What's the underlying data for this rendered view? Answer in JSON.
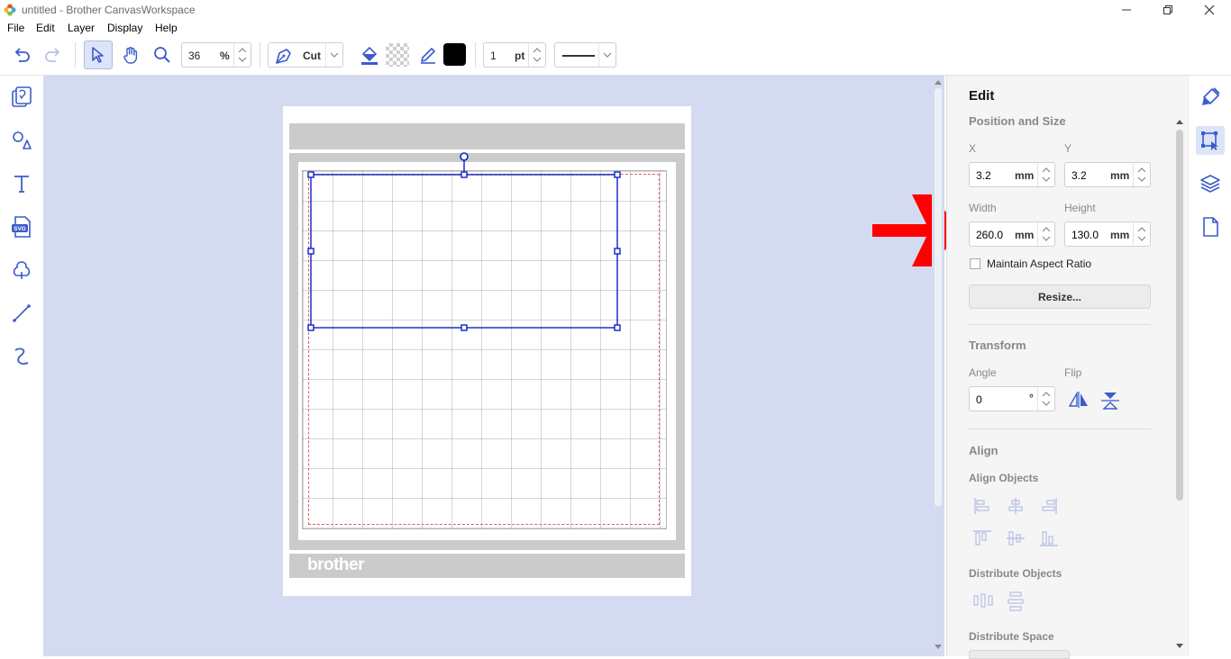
{
  "window": {
    "title": "untitled - Brother CanvasWorkspace"
  },
  "menu": {
    "items": [
      "File",
      "Edit",
      "Layer",
      "Display",
      "Help"
    ]
  },
  "toolbar": {
    "zoom_value": "36",
    "zoom_unit": "%",
    "mode_label": "Cut",
    "line_width_value": "1",
    "line_width_unit": "pt"
  },
  "canvas": {
    "mat_brand": "brother"
  },
  "panel": {
    "title": "Edit",
    "position_size": {
      "heading": "Position and Size",
      "x_label": "X",
      "x_value": "3.2",
      "x_unit": "mm",
      "y_label": "Y",
      "y_value": "3.2",
      "y_unit": "mm",
      "width_label": "Width",
      "width_value": "260.0",
      "width_unit": "mm",
      "height_label": "Height",
      "height_value": "130.0",
      "height_unit": "mm",
      "aspect_label": "Maintain Aspect Ratio",
      "resize_label": "Resize..."
    },
    "transform": {
      "heading": "Transform",
      "angle_label": "Angle",
      "angle_value": "0",
      "angle_unit": "°",
      "flip_label": "Flip"
    },
    "align": {
      "heading": "Align",
      "align_objects_label": "Align Objects",
      "distribute_objects_label": "Distribute Objects",
      "distribute_space_label": "Distribute Space"
    }
  },
  "colors": {
    "accent": "#3b5bcc",
    "selection": "#0b22c8",
    "canvas_bg": "#d4dbf0",
    "arrow": "#ff0000"
  }
}
